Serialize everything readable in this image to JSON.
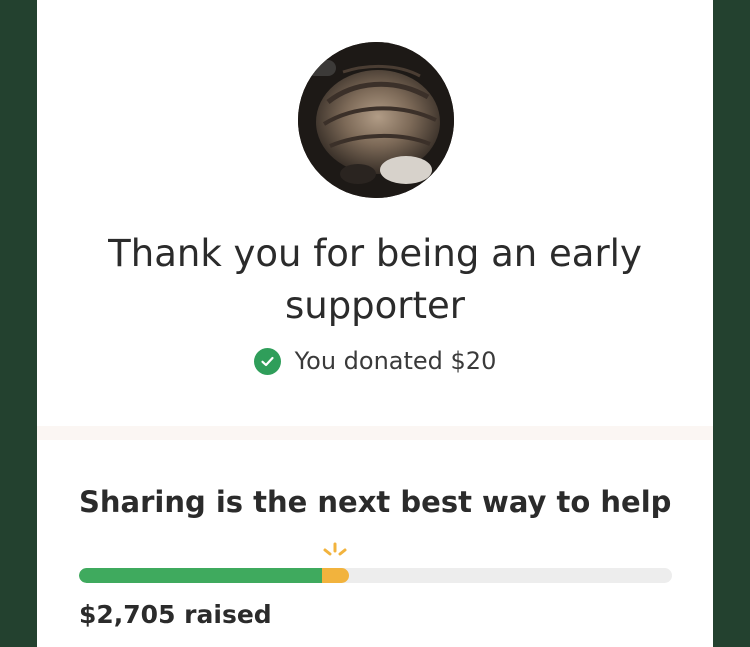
{
  "campaign": {
    "thank_you_title": "Thank you for being an early supporter",
    "donation_text": "You donated $20",
    "share_heading": "Sharing is the next best way to help",
    "raised_text": "$2,705 raised"
  },
  "progress": {
    "raised_fraction": 0.41,
    "new_donation_fraction": 0.045
  },
  "icons": {
    "donation_check": "check-circle-icon",
    "progress_sparkle": "sparkle-icon"
  },
  "colors": {
    "background": "#23412f",
    "card": "#ffffff",
    "progress_green": "#3faa5e",
    "progress_yellow": "#f2b33d",
    "check_green": "#2f9e5a"
  }
}
